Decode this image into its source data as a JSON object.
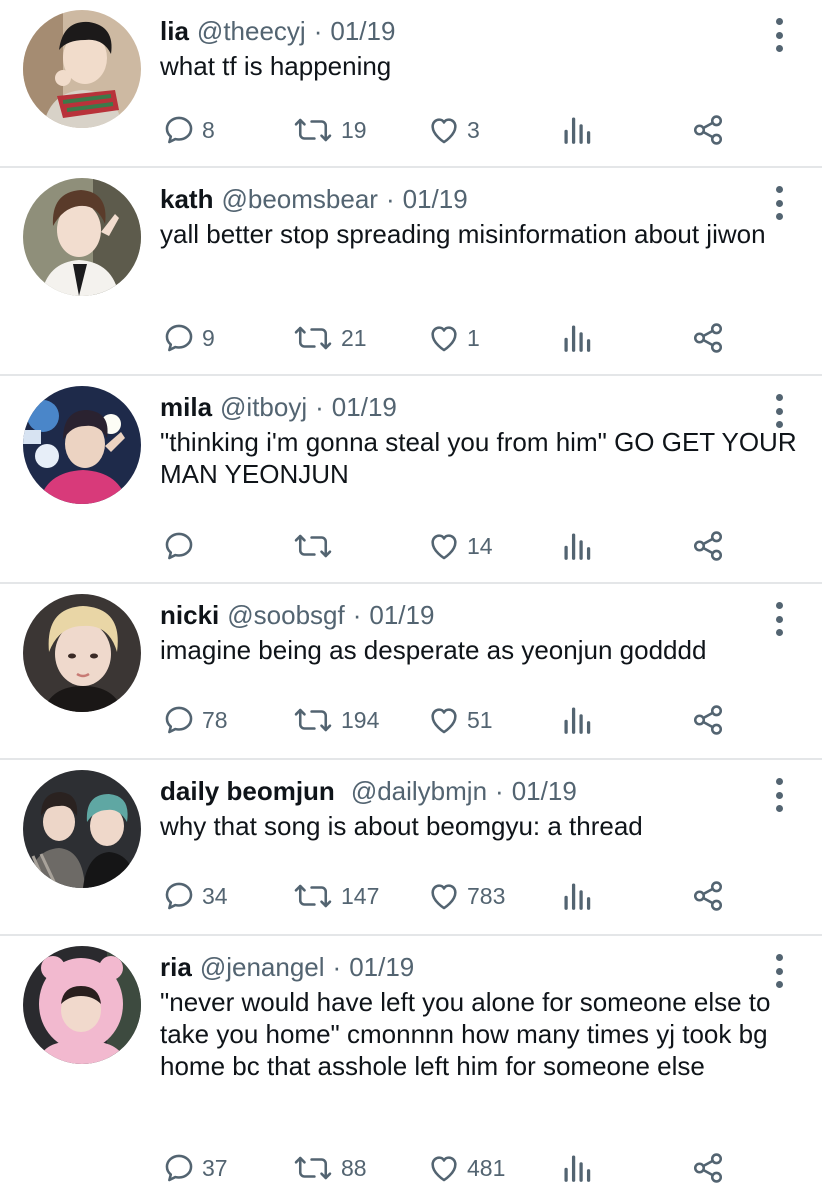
{
  "tweets": [
    {
      "name": "lia",
      "handle": "@theecyj",
      "date": "01/19",
      "text": "what tf is happening",
      "replies": "8",
      "retweets": "19",
      "likes": "3"
    },
    {
      "name": "kath",
      "handle": "@beomsbear",
      "date": "01/19",
      "text": "yall better stop spreading misinformation about jiwon",
      "replies": "9",
      "retweets": "21",
      "likes": "1"
    },
    {
      "name": "mila",
      "handle": "@itboyj",
      "date": "01/19",
      "text": "\"thinking i'm gonna steal you from him\" GO GET YOUR MAN YEONJUN",
      "replies": "",
      "retweets": "",
      "likes": "14"
    },
    {
      "name": "nicki",
      "handle": "@soobsgf",
      "date": "01/19",
      "text": "imagine being as desperate as yeonjun godddd",
      "replies": "78",
      "retweets": "194",
      "likes": "51"
    },
    {
      "name": "daily beomjun",
      "handle": "@dailybmjn",
      "date": "01/19",
      "text": "why that song is about beomgyu: a thread",
      "replies": "34",
      "retweets": "147",
      "likes": "783"
    },
    {
      "name": "ria",
      "handle": "@jenangel",
      "date": "01/19",
      "text": "\"never would have left you alone for someone else to take you home\" cmonnnn how many times yj took bg home bc that asshole left him for someone else",
      "replies": "37",
      "retweets": "88",
      "likes": "481"
    }
  ],
  "separator": "·",
  "icons": {
    "reply": "reply-icon",
    "retweet": "retweet-icon",
    "like": "heart-icon",
    "views": "views-icon",
    "share": "share-icon",
    "more": "more-vertical-icon"
  },
  "colors": {
    "text": "#0f1419",
    "muted": "#536471",
    "divider": "#e4e6e8"
  }
}
